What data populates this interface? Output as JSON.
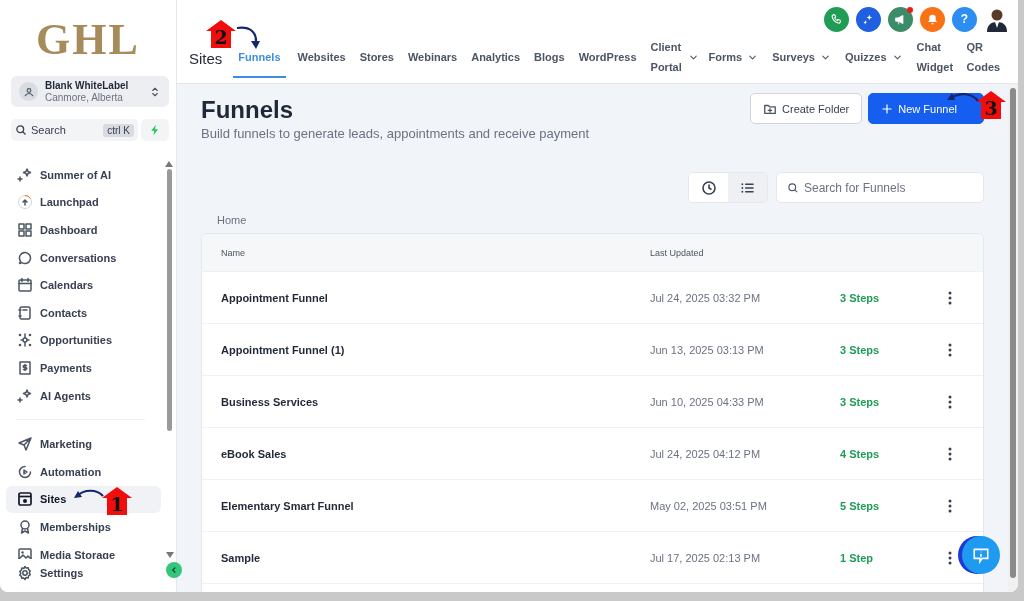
{
  "logo": {
    "text": "GHL"
  },
  "account": {
    "name": "Blank WhiteLabel",
    "location": "Canmore, Alberta"
  },
  "sidebar_search": {
    "placeholder": "Search",
    "shortcut": "ctrl K"
  },
  "sidebar": {
    "items": [
      {
        "label": "Summer of AI",
        "selected": false
      },
      {
        "label": "Launchpad",
        "selected": false
      },
      {
        "label": "Dashboard",
        "selected": false
      },
      {
        "label": "Conversations",
        "selected": false
      },
      {
        "label": "Calendars",
        "selected": false
      },
      {
        "label": "Contacts",
        "selected": false
      },
      {
        "label": "Opportunities",
        "selected": false
      },
      {
        "label": "Payments",
        "selected": false
      },
      {
        "label": "AI Agents",
        "selected": false
      }
    ],
    "secondary_items": [
      {
        "label": "Marketing",
        "selected": false
      },
      {
        "label": "Automation",
        "selected": false
      },
      {
        "label": "Sites",
        "selected": true
      },
      {
        "label": "Memberships",
        "selected": false
      },
      {
        "label": "Media Storage",
        "selected": false
      }
    ],
    "footer_item": {
      "label": "Settings"
    }
  },
  "header_actions": [
    {
      "color": "#1f9d55",
      "badge": false
    },
    {
      "color": "#1f5fe0",
      "badge": false
    },
    {
      "color": "#3b8c69",
      "badge": true
    },
    {
      "color": "#f97316",
      "badge": false
    },
    {
      "color": "#2b8ef0",
      "badge": false,
      "text": "?"
    }
  ],
  "section_title": "Sites",
  "tabs": [
    {
      "label": "Funnels",
      "selected": true,
      "dropdown": false
    },
    {
      "label": "Websites",
      "selected": false,
      "dropdown": false
    },
    {
      "label": "Stores",
      "selected": false,
      "dropdown": false
    },
    {
      "label": "Webinars",
      "selected": false,
      "dropdown": false
    },
    {
      "label": "Analytics",
      "selected": false,
      "dropdown": false
    },
    {
      "label": "Blogs",
      "selected": false,
      "dropdown": false
    },
    {
      "label": "WordPress",
      "selected": false,
      "dropdown": false
    },
    {
      "label": "Client Portal",
      "selected": false,
      "dropdown": true
    },
    {
      "label": "Forms",
      "selected": false,
      "dropdown": true
    },
    {
      "label": "Surveys",
      "selected": false,
      "dropdown": true
    },
    {
      "label": "Quizzes",
      "selected": false,
      "dropdown": true
    },
    {
      "label": "Chat Widget",
      "selected": false,
      "dropdown": false
    },
    {
      "label": "QR Codes",
      "selected": false,
      "dropdown": false
    }
  ],
  "page": {
    "title": "Funnels",
    "subtitle": "Build funnels to generate leads, appointments and receive payment",
    "buttons": [
      {
        "label": "Create Folder",
        "kind": "secondary"
      },
      {
        "label": "New Funnel",
        "kind": "primary"
      }
    ],
    "view_toggle": [
      {
        "selected": false
      },
      {
        "selected": true
      }
    ],
    "search": {
      "placeholder": "Search for Funnels"
    },
    "breadcrumb": "Home"
  },
  "table": {
    "columns": [
      "Name",
      "Last Updated"
    ],
    "rows": [
      {
        "name": "Appointment Funnel",
        "updated": "Jul 24, 2025 03:32 PM",
        "steps": "3 Steps"
      },
      {
        "name": "Appointment Funnel (1)",
        "updated": "Jun 13, 2025 03:13 PM",
        "steps": "3 Steps"
      },
      {
        "name": "Business Services",
        "updated": "Jun 10, 2025 04:33 PM",
        "steps": "3 Steps"
      },
      {
        "name": "eBook Sales",
        "updated": "Jul 24, 2025 04:12 PM",
        "steps": "4 Steps"
      },
      {
        "name": "Elementary Smart Funnel",
        "updated": "May 02, 2025 03:51 PM",
        "steps": "5 Steps"
      },
      {
        "name": "Sample",
        "updated": "Jul 17, 2025 02:13 PM",
        "steps": "1 Step"
      }
    ]
  },
  "annotations": [
    {
      "label": "1"
    },
    {
      "label": "2"
    },
    {
      "label": "3"
    }
  ]
}
